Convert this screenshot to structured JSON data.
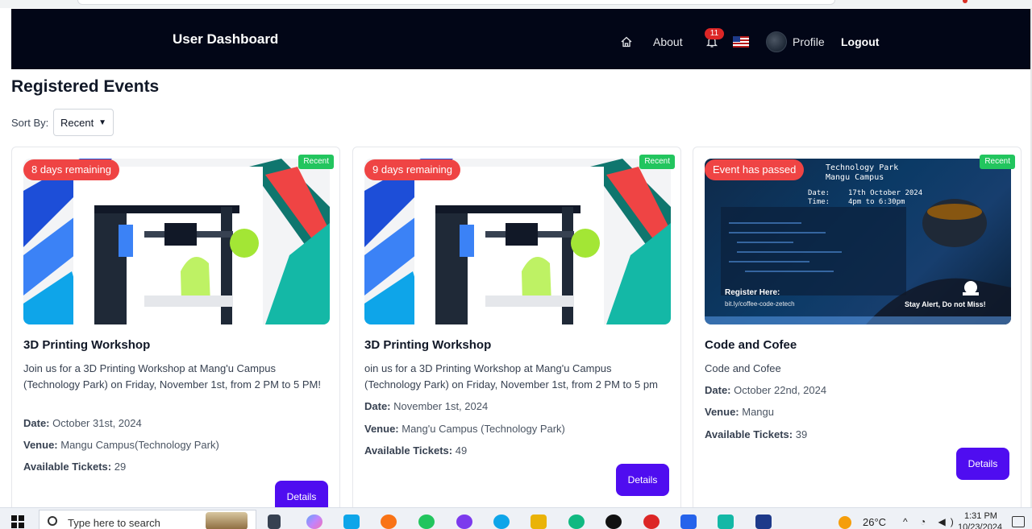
{
  "navbar": {
    "title": "User Dashboard",
    "about": "About",
    "notification_count": "11",
    "profile": "Profile",
    "logout": "Logout"
  },
  "page": {
    "title": "Registered Events",
    "sort_label": "Sort By:",
    "sort_value": "Recent"
  },
  "events": [
    {
      "badge": "Recent",
      "status": "8 days remaining",
      "title": "3D Printing Workshop",
      "description": "Join us for a 3D Printing Workshop at Mang'u Campus (Technology Park) on Friday, November 1st, from 2 PM to 5 PM!",
      "date_label": "Date:",
      "date": "October 31st, 2024",
      "venue_label": "Venue:",
      "venue": "Mangu Campus(Technology Park)",
      "tickets_label": "Available Tickets:",
      "tickets": "29",
      "details": "Details"
    },
    {
      "badge": "Recent",
      "status": "9 days remaining",
      "title": "3D Printing Workshop",
      "description": "oin us for a 3D Printing Workshop at Mang'u Campus (Technology Park) on Friday, November 1st, from 2 PM to 5 pm",
      "date_label": "Date:",
      "date": "November 1st, 2024",
      "venue_label": "Venue:",
      "venue": "Mang'u Campus (Technology Park)",
      "tickets_label": "Available Tickets:",
      "tickets": "49",
      "details": "Details"
    },
    {
      "badge": "Recent",
      "status": "Event has passed",
      "title": "Code and Cofee",
      "description": "Code and Cofee",
      "date_label": "Date:",
      "date": "October 22nd, 2024",
      "venue_label": "Venue:",
      "venue": "Mangu",
      "tickets_label": "Available Tickets:",
      "tickets": "39",
      "details": "Details",
      "poster": {
        "line1": "Technology Park",
        "line2": "Mangu Campus",
        "date_label": "Date:",
        "date": "17th October 2024",
        "time_label": "Time:",
        "time": "4pm to 6:30pm",
        "register": "Register Here:",
        "link": "bit.ly/coffee-code-zetech",
        "alert": "Stay Alert, Do not Miss!"
      }
    }
  ],
  "taskbar": {
    "search_placeholder": "Type here to search",
    "weather": "26°C",
    "time": "1:31 PM",
    "date": "10/23/2024"
  }
}
